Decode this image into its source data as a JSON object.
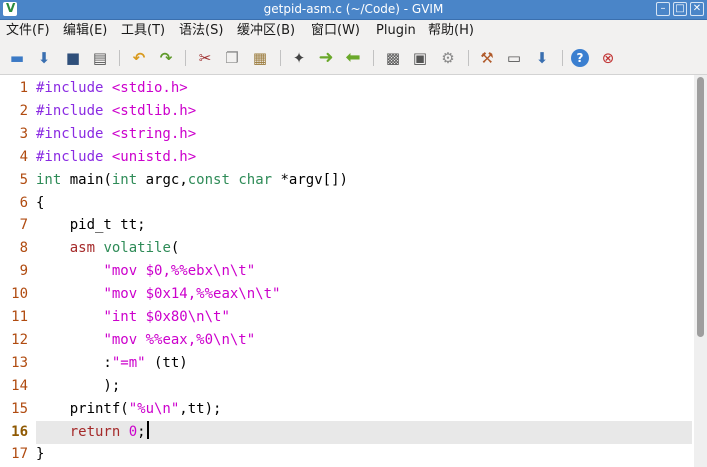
{
  "window": {
    "title": "getpid-asm.c (~/Code) - GVIM",
    "icon": "vim-icon",
    "controls": [
      "minimize-icon",
      "maximize-icon",
      "close-icon"
    ]
  },
  "menu": [
    "文件(F)",
    "编辑(E)",
    "工具(T)",
    "语法(S)",
    "缓冲区(B)",
    "窗口(W)",
    "Plugin",
    "帮助(H)"
  ],
  "toolbar": [
    {
      "name": "open-icon",
      "glyph": "📂"
    },
    {
      "name": "load-session-icon",
      "glyph": "⬇"
    },
    {
      "name": "save-icon",
      "glyph": "💾"
    },
    {
      "name": "print-icon",
      "glyph": "🖶"
    },
    {
      "name": "undo-icon",
      "glyph": "↶"
    },
    {
      "name": "redo-icon",
      "glyph": "↷"
    },
    {
      "name": "cut-icon",
      "glyph": "✂"
    },
    {
      "name": "copy-icon",
      "glyph": "❐"
    },
    {
      "name": "paste-icon",
      "glyph": "📋"
    },
    {
      "name": "find-replace-icon",
      "glyph": "⚙"
    },
    {
      "name": "find-next-icon",
      "glyph": "➜"
    },
    {
      "name": "find-prev-icon",
      "glyph": "⬅"
    },
    {
      "name": "load-script-icon",
      "glyph": "▤"
    },
    {
      "name": "save-session-icon",
      "glyph": "▣"
    },
    {
      "name": "run-script-icon",
      "glyph": "⚙"
    },
    {
      "name": "make-icon",
      "glyph": "⚒"
    },
    {
      "name": "shell-icon",
      "glyph": "▭"
    },
    {
      "name": "ctags-icon",
      "glyph": "⬇"
    },
    {
      "name": "help-icon",
      "glyph": "?"
    },
    {
      "name": "find-help-icon",
      "glyph": "⊗"
    }
  ],
  "editor": {
    "current_line": 16,
    "colors": {
      "line_number": "#b04b10",
      "preproc": "#8a2be2",
      "string": "#cc00cc",
      "type": "#2e8b57",
      "statement": "#a52a2a",
      "number": "#cc00cc",
      "normal": "#000000",
      "current_line_bg": "#e8e8e8"
    },
    "lines": [
      {
        "n": "1",
        "tokens": [
          [
            "pre",
            "#include "
          ],
          [
            "str",
            "<stdio.h>"
          ]
        ]
      },
      {
        "n": "2",
        "tokens": [
          [
            "pre",
            "#include "
          ],
          [
            "str",
            "<stdlib.h>"
          ]
        ]
      },
      {
        "n": "3",
        "tokens": [
          [
            "pre",
            "#include "
          ],
          [
            "str",
            "<string.h>"
          ]
        ]
      },
      {
        "n": "4",
        "tokens": [
          [
            "pre",
            "#include "
          ],
          [
            "str",
            "<unistd.h>"
          ]
        ]
      },
      {
        "n": "5",
        "tokens": [
          [
            "type",
            "int"
          ],
          [
            "norm",
            " main("
          ],
          [
            "type",
            "int"
          ],
          [
            "norm",
            " argc,"
          ],
          [
            "type",
            "const"
          ],
          [
            "norm",
            " "
          ],
          [
            "type",
            "char"
          ],
          [
            "norm",
            " *argv[])"
          ]
        ]
      },
      {
        "n": "6",
        "tokens": [
          [
            "norm",
            "{"
          ]
        ]
      },
      {
        "n": "7",
        "tokens": [
          [
            "norm",
            "    pid_t tt;"
          ]
        ]
      },
      {
        "n": "8",
        "tokens": [
          [
            "norm",
            "    "
          ],
          [
            "stmt",
            "asm"
          ],
          [
            "norm",
            " "
          ],
          [
            "type",
            "volatile"
          ],
          [
            "norm",
            "("
          ]
        ]
      },
      {
        "n": "9",
        "tokens": [
          [
            "norm",
            "        "
          ],
          [
            "str",
            "\"mov $0,%%ebx\\n\\t\""
          ]
        ]
      },
      {
        "n": "10",
        "tokens": [
          [
            "norm",
            "        "
          ],
          [
            "str",
            "\"mov $0x14,%%eax\\n\\t\""
          ]
        ]
      },
      {
        "n": "11",
        "tokens": [
          [
            "norm",
            "        "
          ],
          [
            "str",
            "\"int $0x80\\n\\t\""
          ]
        ]
      },
      {
        "n": "12",
        "tokens": [
          [
            "norm",
            "        "
          ],
          [
            "str",
            "\"mov %%eax,%0\\n\\t\""
          ]
        ]
      },
      {
        "n": "13",
        "tokens": [
          [
            "norm",
            "        :"
          ],
          [
            "str",
            "\"=m\""
          ],
          [
            "norm",
            " (tt)"
          ]
        ]
      },
      {
        "n": "14",
        "tokens": [
          [
            "norm",
            "        );"
          ]
        ]
      },
      {
        "n": "15",
        "tokens": [
          [
            "norm",
            "    printf("
          ],
          [
            "str",
            "\"%u\\n\""
          ],
          [
            "norm",
            ",tt);"
          ]
        ]
      },
      {
        "n": "16",
        "tokens": [
          [
            "norm",
            "    "
          ],
          [
            "stmt",
            "return"
          ],
          [
            "norm",
            " "
          ],
          [
            "num",
            "0"
          ],
          [
            "norm",
            ";"
          ]
        ]
      },
      {
        "n": "17",
        "tokens": [
          [
            "norm",
            "}"
          ]
        ]
      }
    ]
  }
}
